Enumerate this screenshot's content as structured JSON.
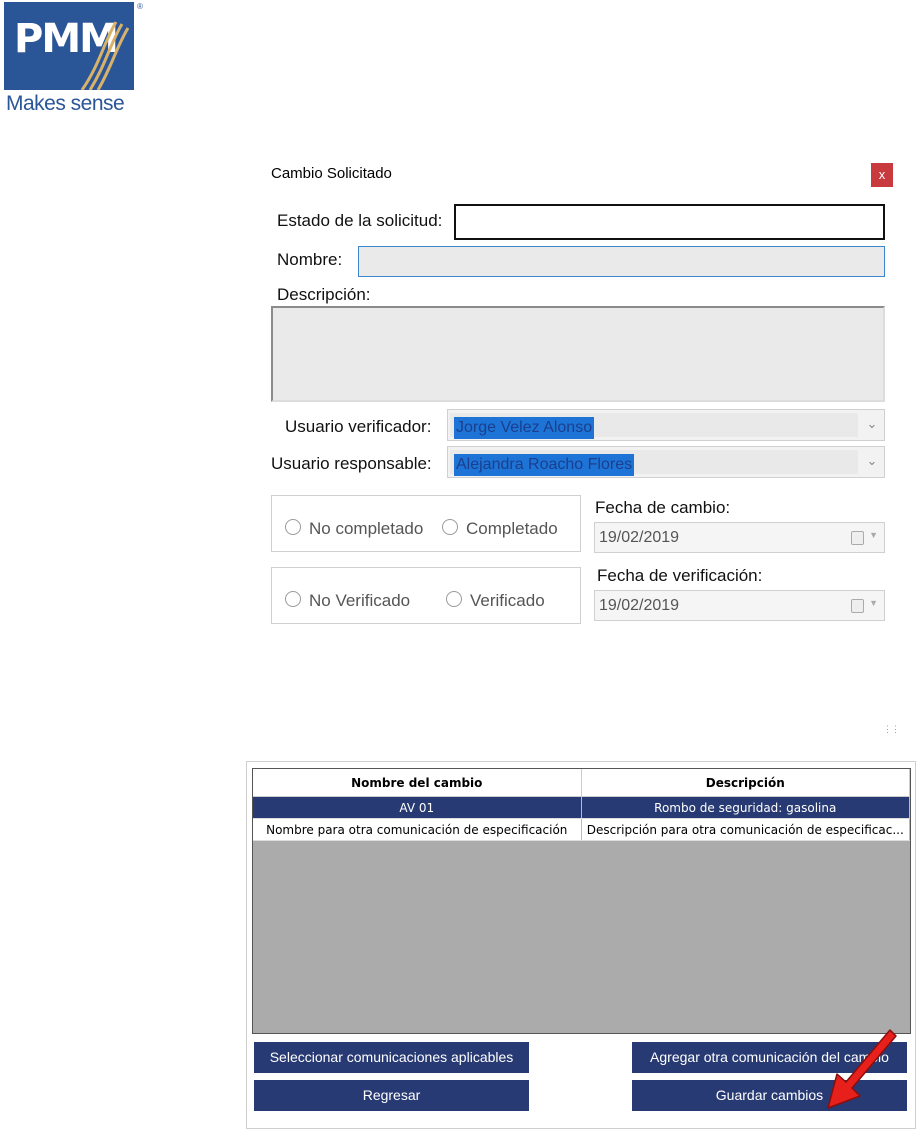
{
  "logo": {
    "mark": "PMM",
    "tagline": "Makes sense",
    "registered": "®"
  },
  "dialog": {
    "title": "Cambio Solicitado",
    "close_label": "x",
    "estado_label": "Estado de la solicitud:",
    "estado_value": "",
    "nombre_label": "Nombre:",
    "nombre_value": "",
    "descripcion_label": "Descripción:",
    "descripcion_value": "",
    "usuario_verificador_label": "Usuario verificador:",
    "usuario_verificador_value": "Jorge Velez Alonso",
    "usuario_responsable_label": "Usuario responsable:",
    "usuario_responsable_value": "Alejandra Roacho Flores",
    "status_options": [
      "No completado",
      "Completado"
    ],
    "verify_options": [
      "No Verificado",
      "Verificado"
    ],
    "fecha_cambio_label": "Fecha de cambio:",
    "fecha_cambio_value": "19/02/2019",
    "fecha_verificacion_label": "Fecha de verificación:",
    "fecha_verificacion_value": "19/02/2019"
  },
  "grid": {
    "columns": [
      "Nombre del cambio",
      "Descripción"
    ],
    "rows": [
      {
        "nombre": "AV 01",
        "descripcion": "Rombo de seguridad: gasolina",
        "selected": true
      },
      {
        "nombre": "Nombre para otra comunicación de especificación",
        "descripcion": "Descripción para otra comunicación de especificac...",
        "selected": false
      }
    ]
  },
  "buttons": {
    "seleccionar": "Seleccionar comunicaciones aplicables",
    "agregar": "Agregar otra comunicación del cambio",
    "regresar": "Regresar",
    "guardar": "Guardar cambios"
  },
  "colors": {
    "brand": "#2a5698",
    "button": "#283a73",
    "close": "#c93a3e",
    "annotation_arrow": "#e8201c",
    "selection": "#1e74d6"
  },
  "icons": [
    "close-icon",
    "chevron-down-icon",
    "calendar-icon",
    "resize-grip-icon",
    "annotation-arrow-icon"
  ]
}
